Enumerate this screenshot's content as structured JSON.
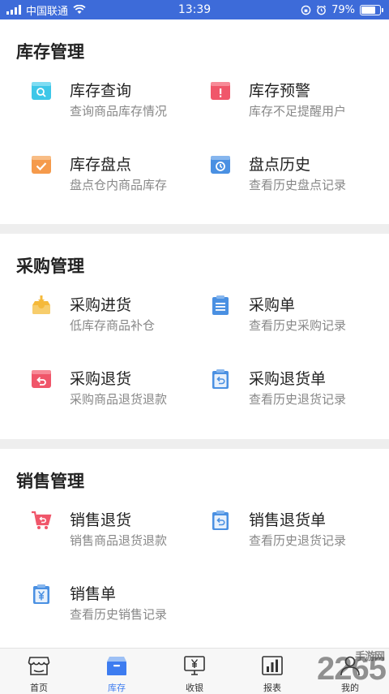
{
  "status_bar": {
    "carrier": "中国联通",
    "time": "13:39",
    "battery": "79%",
    "battery_level": 0.79
  },
  "sections": [
    {
      "title": "库存管理",
      "items": [
        {
          "title": "库存查询",
          "subtitle": "查询商品库存情况",
          "icon": "search-box-icon",
          "color": "#3ec7e8"
        },
        {
          "title": "库存预警",
          "subtitle": "库存不足提醒用户",
          "icon": "warning-box-icon",
          "color": "#f0566a"
        },
        {
          "title": "库存盘点",
          "subtitle": "盘点仓内商品库存",
          "icon": "check-box-icon",
          "color": "#f59a4b"
        },
        {
          "title": "盘点历史",
          "subtitle": "查看历史盘点记录",
          "icon": "clock-box-icon",
          "color": "#4a90e2"
        }
      ]
    },
    {
      "title": "采购管理",
      "items": [
        {
          "title": "采购进货",
          "subtitle": "低库存商品补仓",
          "icon": "inbox-download-icon",
          "color": "#f5b93a"
        },
        {
          "title": "采购单",
          "subtitle": "查看历史采购记录",
          "icon": "clipboard-list-icon",
          "color": "#4a90e2"
        },
        {
          "title": "采购退货",
          "subtitle": "采购商品退货退款",
          "icon": "return-box-icon",
          "color": "#f0566a"
        },
        {
          "title": "采购退货单",
          "subtitle": "查看历史退货记录",
          "icon": "clipboard-return-icon",
          "color": "#4a90e2"
        }
      ]
    },
    {
      "title": "销售管理",
      "items": [
        {
          "title": "销售退货",
          "subtitle": "销售商品退货退款",
          "icon": "cart-return-icon",
          "color": "#f0566a"
        },
        {
          "title": "销售退货单",
          "subtitle": "查看历史退货记录",
          "icon": "clipboard-return-icon",
          "color": "#4a90e2"
        },
        {
          "title": "销售单",
          "subtitle": "查看历史销售记录",
          "icon": "clipboard-yen-icon",
          "color": "#4a90e2"
        }
      ]
    }
  ],
  "nav": {
    "items": [
      {
        "label": "首页",
        "icon": "store-icon",
        "active": false
      },
      {
        "label": "库存",
        "icon": "box-icon",
        "active": true
      },
      {
        "label": "收银",
        "icon": "cashier-monitor-icon",
        "active": false
      },
      {
        "label": "报表",
        "icon": "bar-chart-icon",
        "active": false
      },
      {
        "label": "我的",
        "icon": "user-icon",
        "active": false
      }
    ],
    "active_color": "#3d7cf0"
  },
  "watermark": {
    "text": "2265",
    "subtext": "手游网"
  }
}
